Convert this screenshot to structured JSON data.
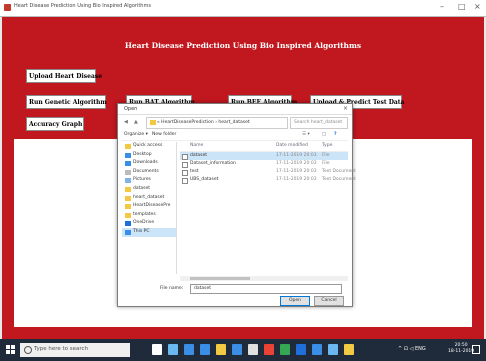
{
  "window": {
    "title": "Heart Disease Prediction Using Bio Inspired Algorithms",
    "controls": {
      "minimize": "–",
      "maximize": "□",
      "close": "×"
    }
  },
  "app": {
    "heading": "Heart Disease Prediction Using Bio Inspired Algorithms",
    "buttons": {
      "upload": "Upload Heart Disease",
      "genetic": "Run Genetic Algorithm",
      "bat": "Run BAT Algorithm",
      "bee": "Run BEE Algorithm",
      "predict": "Upload & Predict Test Data",
      "accuracy": "Accuracy Graph"
    }
  },
  "dialog": {
    "title": "Open",
    "close": "×",
    "address": "« HeartDiseasePrediction › heart_dataset",
    "search_placeholder": "Search heart_dataset",
    "toolbar": {
      "organize": "Organize ▾",
      "new_folder": "New folder"
    },
    "nav_items": [
      "Quick access",
      "Desktop",
      "Downloads",
      "Documents",
      "Pictures",
      "dataset",
      "heart_dataset",
      "HeartDiseasePre",
      "templates",
      "OneDrive",
      "This PC"
    ],
    "columns": {
      "name": "Name",
      "date": "Date modified",
      "type": "Type"
    },
    "files": [
      {
        "name": "dataset",
        "date": "17-11-2019 20:03",
        "type": "File"
      },
      {
        "name": "Dataset_information",
        "date": "17-11-2019 20:03",
        "type": "File"
      },
      {
        "name": "test",
        "date": "17-11-2019 20:03",
        "type": "Text Document"
      },
      {
        "name": "UBS_dataset",
        "date": "17-11-2019 20:03",
        "type": "Text Document"
      }
    ],
    "filename_label": "File name:",
    "filename_value": "dataset",
    "open_label": "Open",
    "cancel_label": "Cancel"
  },
  "taskbar": {
    "search_placeholder": "Type here to search",
    "time": "20:50",
    "date": "18-11-2019",
    "tray_text": "^ ⊡ ◁ ENG"
  },
  "colors": {
    "app_bg": "#c1171e",
    "taskbar_bg": "#1f2a3a",
    "selection": "#cce4f7"
  }
}
